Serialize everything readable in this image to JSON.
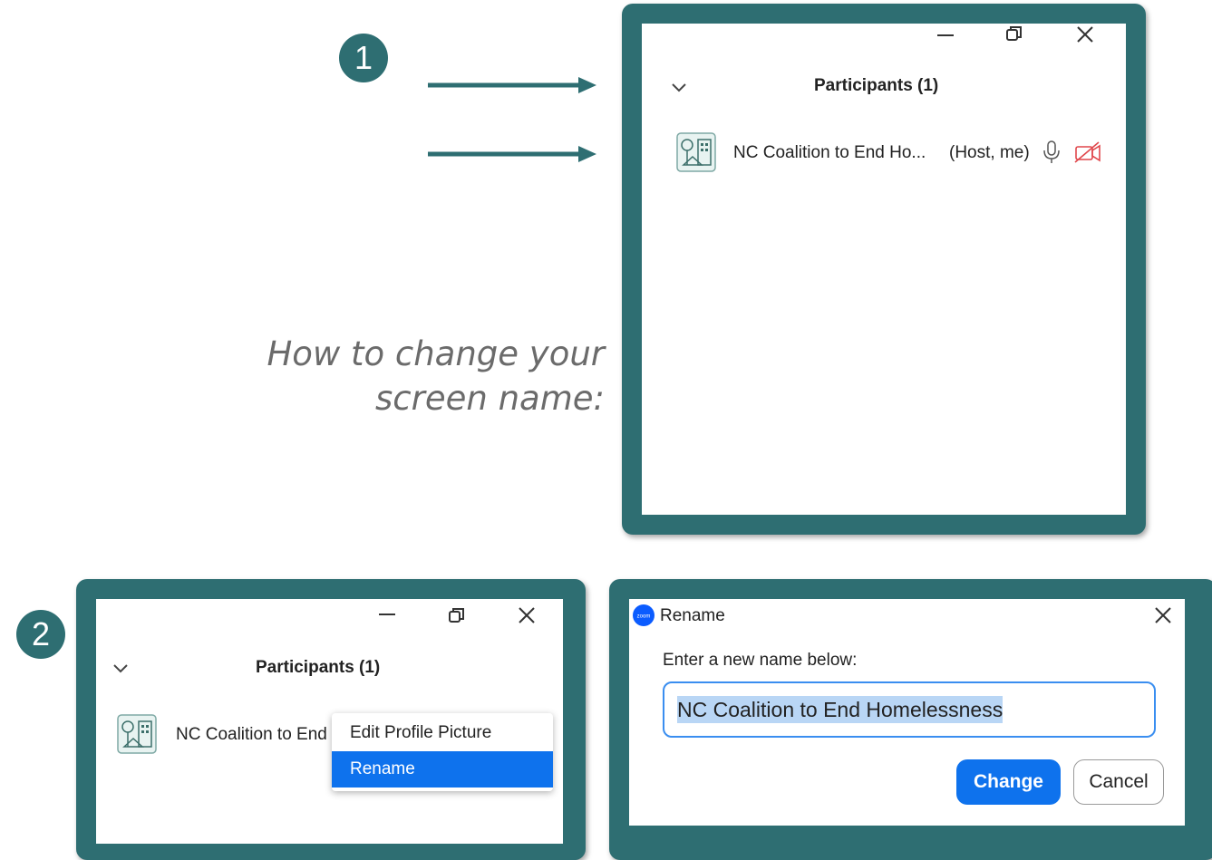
{
  "steps": [
    "1",
    "2"
  ],
  "caption": {
    "line1": "How to change your",
    "line2": "screen name:"
  },
  "panel1": {
    "title": "Participants (1)",
    "participant_name": "NC Coalition to End Ho...",
    "participant_role": "(Host, me)"
  },
  "panel2": {
    "title": "Participants (1)",
    "participant_name": "NC Coalition to End",
    "menu": [
      "Edit Profile Picture",
      "Rename"
    ]
  },
  "rename_dialog": {
    "title": "Rename",
    "prompt": "Enter a new name below:",
    "value": "NC Coalition to End Homelessness",
    "change_label": "Change",
    "cancel_label": "Cancel"
  },
  "colors": {
    "frame": "#2e6e72",
    "accent": "#0e72ed",
    "muted_video": "#e0474c"
  },
  "icons": [
    "minimize-icon",
    "restore-icon",
    "close-icon",
    "chevron-down-icon",
    "avatar-icon",
    "microphone-icon",
    "video-off-icon",
    "zoom-logo-icon"
  ]
}
